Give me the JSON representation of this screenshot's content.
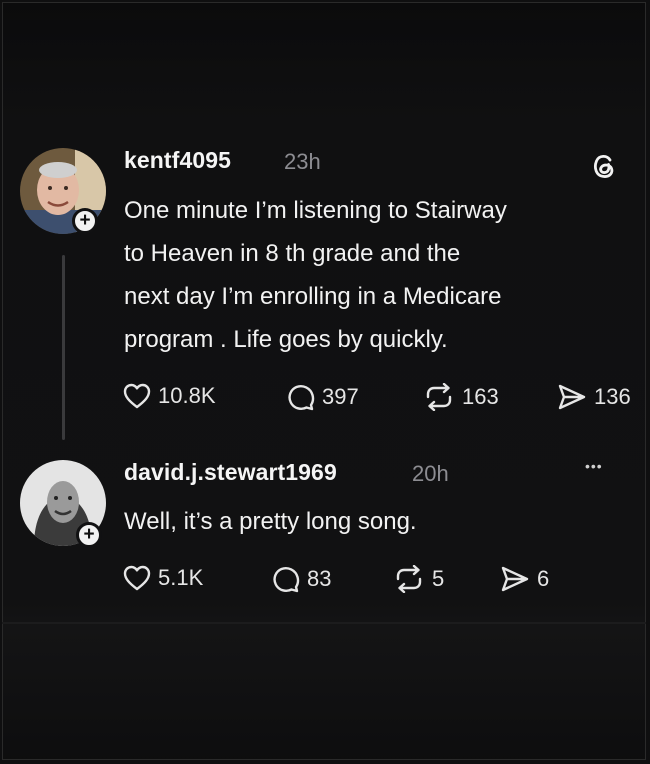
{
  "posts": [
    {
      "username": "kentf4095",
      "time": "23h",
      "text": "One minute I’m listening to Stairway\nto Heaven in 8 th grade and the\nnext day I’m enrolling in a Medicare\nprogram . Life goes by quickly.",
      "likes": "10.8K",
      "replies": "397",
      "reposts": "163",
      "shares": "136",
      "corner_icon": "threads-logo-icon"
    },
    {
      "username": "david.j.stewart1969",
      "time": "20h",
      "text": "Well, it’s a pretty long song.",
      "likes": "5.1K",
      "replies": "83",
      "reposts": "5",
      "shares": "6",
      "corner_icon": "more-options-icon",
      "corner_text": "•••"
    }
  ],
  "follow_glyph": "+",
  "colors": {
    "background": "#111112",
    "text": "#f2f2f2",
    "muted": "#8d8d92",
    "thread_line": "#3a3a3c"
  }
}
